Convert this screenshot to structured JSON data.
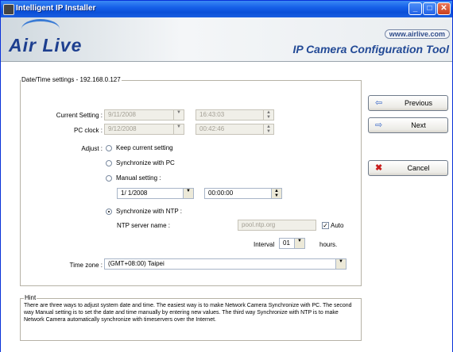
{
  "window": {
    "title": "Intelligent IP Installer"
  },
  "banner": {
    "logo": "Air Live",
    "url": "www.airlive.com",
    "tool_title": "IP Camera Configuration Tool"
  },
  "datetime": {
    "legend": "Date/Time settings - 192.168.0.127",
    "current_setting_label": "Current Setting :",
    "current_date": "9/11/2008",
    "current_time": "16:43:03",
    "pc_clock_label": "PC clock :",
    "pc_date": "9/12/2008",
    "pc_time": "00:42:46",
    "adjust_label": "Adjust :",
    "opt_keep": "Keep current setting",
    "opt_sync_pc": "Synchronize with PC",
    "opt_manual": "Manual setting :",
    "manual_date": "1/  1/2008",
    "manual_time": "00:00:00",
    "opt_ntp": "Synchronize with NTP :",
    "ntp_server_label": "NTP server name :",
    "ntp_server_value": "pool.ntp.org",
    "auto_label": "Auto",
    "auto_checked": "✓",
    "interval_label": "Interval",
    "interval_value": "01",
    "hours_label": "hours.",
    "timezone_label": "Time zone :",
    "timezone_value": "(GMT+08:00) Taipei"
  },
  "hint": {
    "legend": "Hint",
    "text": "There are three ways to adjust system date and time. The easiest way is to make Network Camera Synchronize with PC. The second way Manual setting is to set the date and time manually by entering new values. The third way Synchronize with NTP is to make Network Camera automatically synchronize with timeservers over the Internet."
  },
  "buttons": {
    "previous": "Previous",
    "next": "Next",
    "cancel": "Cancel"
  },
  "icons": {
    "previous": "arrow-left-icon",
    "next": "arrow-right-icon",
    "cancel": "x-icon"
  }
}
